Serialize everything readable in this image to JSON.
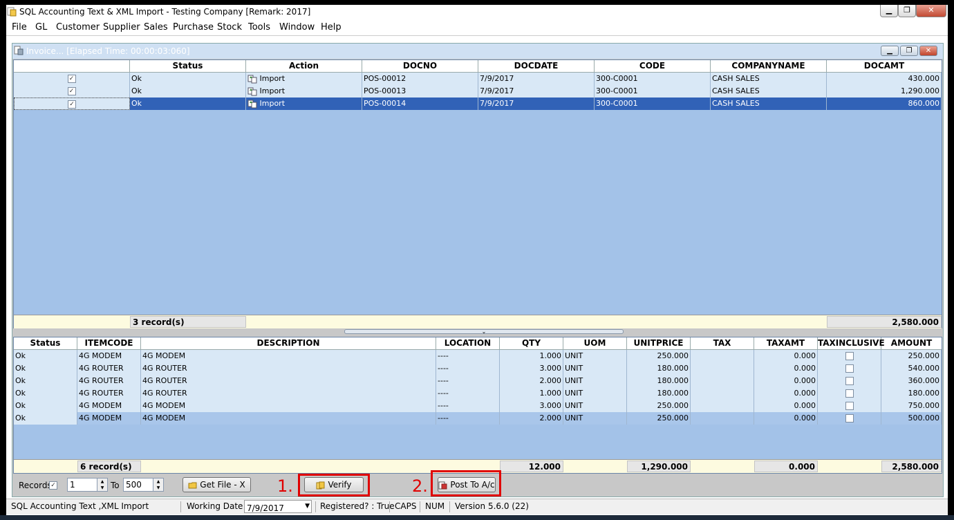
{
  "window": {
    "title": "SQL Accounting Text & XML Import - Testing Company [Remark: 2017]"
  },
  "menu": [
    "File",
    "GL",
    "Customer",
    "Supplier",
    "Sales",
    "Purchase",
    "Stock",
    "Tools",
    "Window",
    "Help"
  ],
  "child_window": {
    "title": "Invoice... [Elapsed Time: 00:00:03:060]"
  },
  "master_grid": {
    "columns": [
      "",
      "Status",
      "Action",
      "DOCNO",
      "DOCDATE",
      "CODE",
      "COMPANYNAME",
      "DOCAMT"
    ],
    "rows": [
      {
        "check": "✓",
        "status": "Ok",
        "action": "Import",
        "docno": "POS-00012",
        "docdate": "7/9/2017",
        "code": "300-C0001",
        "company": "CASH SALES",
        "docamt": "430.000"
      },
      {
        "check": "✓",
        "status": "Ok",
        "action": "Import",
        "docno": "POS-00013",
        "docdate": "7/9/2017",
        "code": "300-C0001",
        "company": "CASH SALES",
        "docamt": "1,290.000"
      },
      {
        "check": "✓",
        "status": "Ok",
        "action": "Import",
        "docno": "POS-00014",
        "docdate": "7/9/2017",
        "code": "300-C0001",
        "company": "CASH SALES",
        "docamt": "860.000"
      }
    ],
    "footer_count": "3 record(s)",
    "footer_total": "2,580.000"
  },
  "detail_grid": {
    "columns": [
      "Status",
      "ITEMCODE",
      "DESCRIPTION",
      "LOCATION",
      "QTY",
      "UOM",
      "UNITPRICE",
      "TAX",
      "TAXAMT",
      "TAXINCLUSIVE",
      "AMOUNT"
    ],
    "rows": [
      {
        "status": "Ok",
        "itemcode": "4G MODEM",
        "description": "4G MODEM",
        "location": "----",
        "qty": "1.000",
        "uom": "UNIT",
        "unitprice": "250.000",
        "tax": "",
        "taxamt": "0.000",
        "amount": "250.000"
      },
      {
        "status": "Ok",
        "itemcode": "4G ROUTER",
        "description": "4G ROUTER",
        "location": "----",
        "qty": "3.000",
        "uom": "UNIT",
        "unitprice": "180.000",
        "tax": "",
        "taxamt": "0.000",
        "amount": "540.000"
      },
      {
        "status": "Ok",
        "itemcode": "4G ROUTER",
        "description": "4G ROUTER",
        "location": "----",
        "qty": "2.000",
        "uom": "UNIT",
        "unitprice": "180.000",
        "tax": "",
        "taxamt": "0.000",
        "amount": "360.000"
      },
      {
        "status": "Ok",
        "itemcode": "4G ROUTER",
        "description": "4G ROUTER",
        "location": "----",
        "qty": "1.000",
        "uom": "UNIT",
        "unitprice": "180.000",
        "tax": "",
        "taxamt": "0.000",
        "amount": "180.000"
      },
      {
        "status": "Ok",
        "itemcode": "4G MODEM",
        "description": "4G MODEM",
        "location": "----",
        "qty": "3.000",
        "uom": "UNIT",
        "unitprice": "250.000",
        "tax": "",
        "taxamt": "0.000",
        "amount": "750.000"
      },
      {
        "status": "Ok",
        "itemcode": "4G MODEM",
        "description": "4G MODEM",
        "location": "----",
        "qty": "2.000",
        "uom": "UNIT",
        "unitprice": "250.000",
        "tax": "",
        "taxamt": "0.000",
        "amount": "500.000"
      }
    ],
    "footer_count": "6 record(s)",
    "footer_qty": "12.000",
    "footer_unitprice": "1,290.000",
    "footer_taxamt": "0.000",
    "footer_amount": "2,580.000"
  },
  "toolbar": {
    "records_label": "Records",
    "records_check": "✓",
    "from_value": "1",
    "to_label": "To",
    "to_value": "500",
    "getfile_label": "Get File - X",
    "verify_label": "Verify",
    "post_label": "Post To A/c",
    "annotation_1": "1.",
    "annotation_2": "2."
  },
  "statusbar": {
    "app": "SQL Accounting Text ,XML Import",
    "working_date_label": "Working Date :",
    "working_date": "7/9/2017",
    "registered": "Registered? : True",
    "caps": "CAPS",
    "num": "NUM",
    "version": "Version 5.6.0 (22)"
  },
  "colors": {
    "selected_row": "#3162b7",
    "grid_bg": "#a3c2e8",
    "annotation": "#e00000"
  }
}
